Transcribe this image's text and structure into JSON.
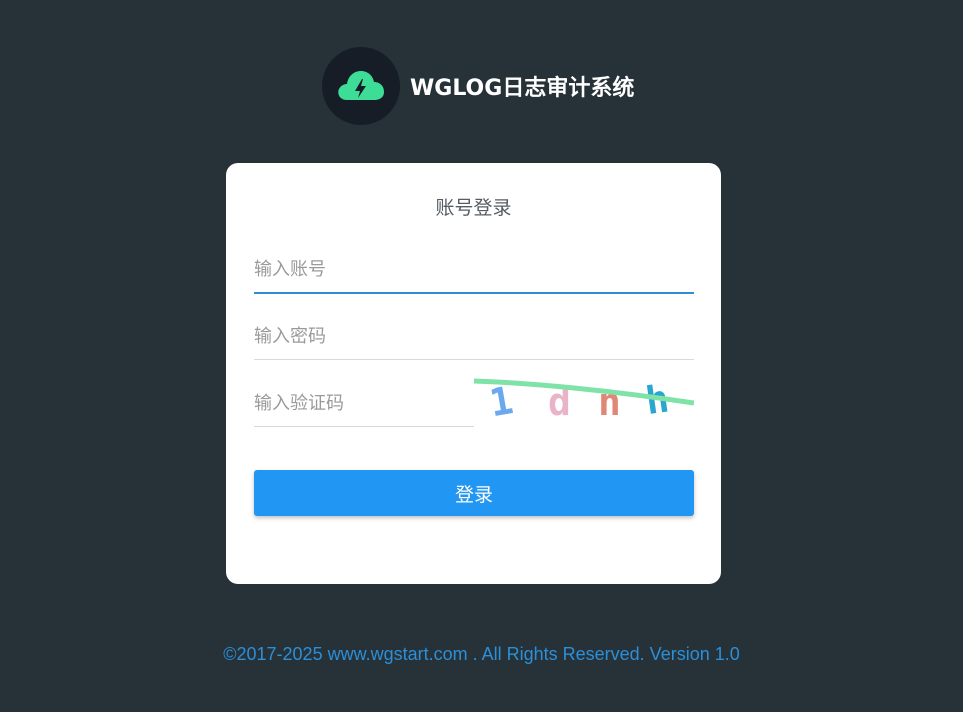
{
  "brand": {
    "title": "WGLOG日志审计系统",
    "logo_icon": "cloud-lightning-icon",
    "logo_color": "#3ddc97"
  },
  "login": {
    "title": "账号登录",
    "username_placeholder": "输入账号",
    "password_placeholder": "输入密码",
    "captcha_placeholder": "输入验证码",
    "captcha_text": "1dnh",
    "submit_label": "登录",
    "accent_color": "#2196f3"
  },
  "footer": {
    "prefix": "©2017-2025 ",
    "link": "www.wgstart.com",
    "suffix": " . All Rights Reserved. Version 1.0"
  }
}
